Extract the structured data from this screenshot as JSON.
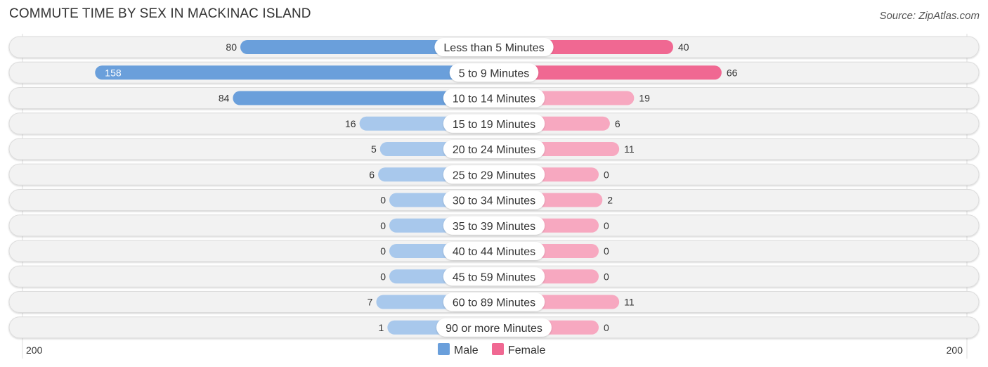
{
  "title": "COMMUTE TIME BY SEX IN MACKINAC ISLAND",
  "source": "Source: ZipAtlas.com",
  "colors": {
    "male": "#6a9fdb",
    "male_light": "#a8c8ec",
    "female": "#f06892",
    "female_light": "#f7a8c0",
    "track": "#f2f2f2"
  },
  "chart_data": {
    "type": "bar",
    "orientation": "horizontal-diverging",
    "title": "COMMUTE TIME BY SEX IN MACKINAC ISLAND",
    "categories": [
      "Less than 5 Minutes",
      "5 to 9 Minutes",
      "10 to 14 Minutes",
      "15 to 19 Minutes",
      "20 to 24 Minutes",
      "25 to 29 Minutes",
      "30 to 34 Minutes",
      "35 to 39 Minutes",
      "40 to 44 Minutes",
      "45 to 59 Minutes",
      "60 to 89 Minutes",
      "90 or more Minutes"
    ],
    "series": [
      {
        "name": "Male",
        "values": [
          80,
          158,
          84,
          16,
          5,
          6,
          0,
          0,
          0,
          0,
          7,
          1
        ]
      },
      {
        "name": "Female",
        "values": [
          40,
          66,
          19,
          6,
          11,
          0,
          2,
          0,
          0,
          0,
          11,
          0
        ]
      }
    ],
    "axis": {
      "left_label": "200",
      "right_label": "200",
      "max": 200
    },
    "legend": {
      "position": "bottom-center",
      "items": [
        "Male",
        "Female"
      ]
    }
  }
}
